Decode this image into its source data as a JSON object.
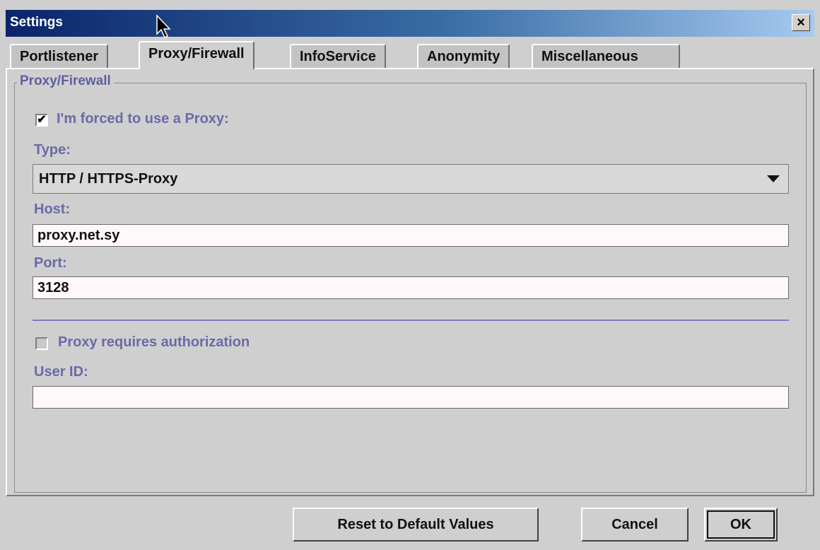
{
  "window": {
    "title": "Settings",
    "close_label": "×"
  },
  "tabs": [
    {
      "label": "Portlistener"
    },
    {
      "label": "Proxy/Firewall",
      "active": true
    },
    {
      "label": "InfoService"
    },
    {
      "label": "Anonymity"
    },
    {
      "label": "Miscellaneous"
    }
  ],
  "group": {
    "legend": "Proxy/Firewall"
  },
  "proxy": {
    "forced_checkbox": {
      "label": "I'm forced to use a Proxy:",
      "checked": true,
      "mark": "✔"
    },
    "type_label": "Type:",
    "type_value": "HTTP / HTTPS-Proxy",
    "host_label": "Host:",
    "host_value": "proxy.net.sy",
    "port_label": "Port:",
    "port_value": "3128",
    "auth_checkbox": {
      "label": "Proxy requires authorization",
      "checked": false
    },
    "user_label": "User ID:",
    "user_value": ""
  },
  "buttons": {
    "reset": "Reset to Default Values",
    "cancel": "Cancel",
    "ok": "OK"
  },
  "icons": {
    "cursor": "mouse-pointer-icon",
    "dropdown": "dropdown-arrow-icon"
  }
}
